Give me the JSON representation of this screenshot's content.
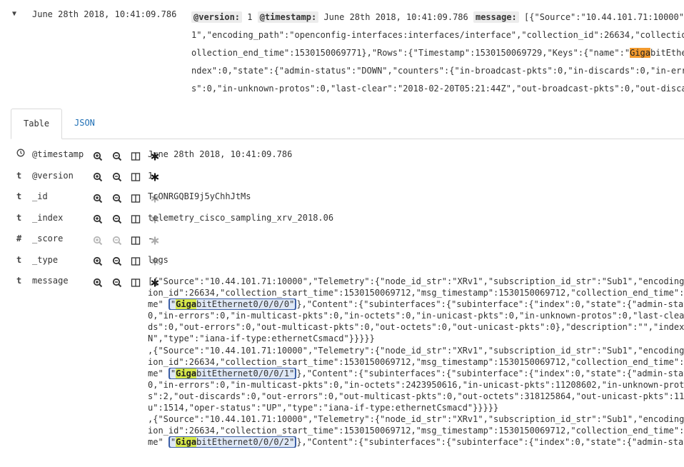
{
  "doc": {
    "timestamp": "June 28th 2018, 10:41:09.786",
    "summary": {
      "version_label": "@version:",
      "version_value": "1",
      "timestamp_label": "@timestamp:",
      "timestamp_value": "June 28th 2018, 10:41:09.786",
      "message_label": "message:",
      "line1_rest": "[{\"Source\":\"10.44.101.71:10000\",\"Telemetry\":{\"node_id_str\":\"XRv1\",\"subscription_id_str\":\"Sub",
      "line2": "1\",\"encoding_path\":\"openconfig-interfaces:interfaces/interface\",\"collection_id\":26634,\"collection_start_time\":1530150069712,\"c",
      "line3": "ollection_end_time\":1530150069771},\"Rows\":{\"Timestamp\":1530150069729,\"Keys\":{\"name\":\"",
      "line3_hl": "Giga",
      "line3_after": "bitEthernet0/0/0/0\"},\"Content\":{\"subinterfaces\":",
      "line4": "ndex\":0,\"state\":{\"admin-status\":\"DOWN\",\"counters\":{\"in-broadcast-pkts\":0,\"in-discards\":0,\"in-errors\":0",
      "line5": "s\":0,\"in-unknown-protos\":0,\"last-clear\":\"2018-02-20T05:21:44Z\",\"out-broadcast-pkts\":0,\"out-discards\":0"
    }
  },
  "tabs": [
    {
      "label": "Table"
    },
    {
      "label": "JSON"
    }
  ],
  "fields": [
    {
      "type": "clock-icon",
      "name": "@timestamp",
      "value": "June 28th 2018, 10:41:09.786"
    },
    {
      "type_text": "t",
      "name": "@version",
      "value": "1"
    },
    {
      "type_text": "t",
      "name": "_id",
      "value": "TcONRGQBI9j5yChhJtMs"
    },
    {
      "type_text": "t",
      "name": "_index",
      "value": "telemetry_cisco_sampling_xrv_2018.06"
    },
    {
      "type_text": "#",
      "name": "_score",
      "value": "-"
    },
    {
      "type_text": "t",
      "name": "_type",
      "value": "logs"
    },
    {
      "type_text": "t",
      "name": "message"
    }
  ],
  "message": {
    "l1": "[{\"Source\":\"10.44.101.71:10000\",\"Telemetry\":{\"node_id_str\":\"XRv1\",\"subscription_id_str\":\"Sub1\",\"encoding_path\"",
    "l2": "ion_id\":26634,\"collection_start_time\":1530150069712,\"msg_timestamp\":1530150069712,\"collection_end_time\":1530",
    "l3_pre": "me\" ",
    "l3_q1": "\"",
    "l3_hl": "Giga",
    "l3_rest": "bitEthernet0/0/0/0\"",
    "l3_post": "},\"Content\":{\"subinterfaces\":{\"subinterface\":{\"index\":0,\"state\":{\"admin-status\":\"",
    "l4": "0,\"in-errors\":0,\"in-multicast-pkts\":0,\"in-octets\":0,\"in-unicast-pkts\":0,\"in-unknown-protos\":0,\"last-clear\":",
    "l5": "ds\":0,\"out-errors\":0,\"out-multicast-pkts\":0,\"out-octets\":0,\"out-unicast-pkts\":0},\"description\":\"\",\"index\":0,",
    "l6": "N\",\"type\":\"iana-if-type:ethernetCsmacd\"}}}}}",
    "l7": ",{\"Source\":\"10.44.101.71:10000\",\"Telemetry\":{\"node_id_str\":\"XRv1\",\"subscription_id_str\":\"Sub1\",\"encoding_path\"",
    "l8": "ion_id\":26634,\"collection_start_time\":1530150069712,\"msg_timestamp\":1530150069712,\"collection_end_time\":1530",
    "l9_pre": "me\" ",
    "l9_q1": "\"",
    "l9_hl": "Giga",
    "l9_rest": "bitEthernet0/0/0/1\"",
    "l9_post": "},\"Content\":{\"subinterfaces\":{\"subinterface\":{\"index\":0,\"state\":{\"admin-status\":\"",
    "l10": "0,\"in-errors\":0,\"in-multicast-pkts\":0,\"in-octets\":2423950616,\"in-unicast-pkts\":11208602,\"in-unknown-protos\":",
    "l11": "s\":2,\"out-discards\":0,\"out-errors\":0,\"out-multicast-pkts\":0,\"out-octets\":318125864,\"out-unicast-pkts\":1142",
    "l12": "u\":1514,\"oper-status\":\"UP\",\"type\":\"iana-if-type:ethernetCsmacd\"}}}}}",
    "l13": ",{\"Source\":\"10.44.101.71:10000\",\"Telemetry\":{\"node_id_str\":\"XRv1\",\"subscription_id_str\":\"Sub1\",\"encoding_path\"",
    "l14": "ion_id\":26634,\"collection_start_time\":1530150069712,\"msg_timestamp\":1530150069712,\"collection_end_time\":1530",
    "l15_pre": "me\" ",
    "l15_q1": "\"",
    "l15_hl": "Giga",
    "l15_rest": "bitEthernet0/0/0/2\"",
    "l15_post": "},\"Content\":{\"subinterfaces\":{\"subinterface\":{\"index\":0,\"state\":{\"admin-status\":\""
  },
  "colors": {
    "tab_link": "#1f6fb5",
    "highlight_orange": "#f29a2e",
    "highlight_yellow": "#d6e84a",
    "box_border": "#3c5fa6"
  }
}
